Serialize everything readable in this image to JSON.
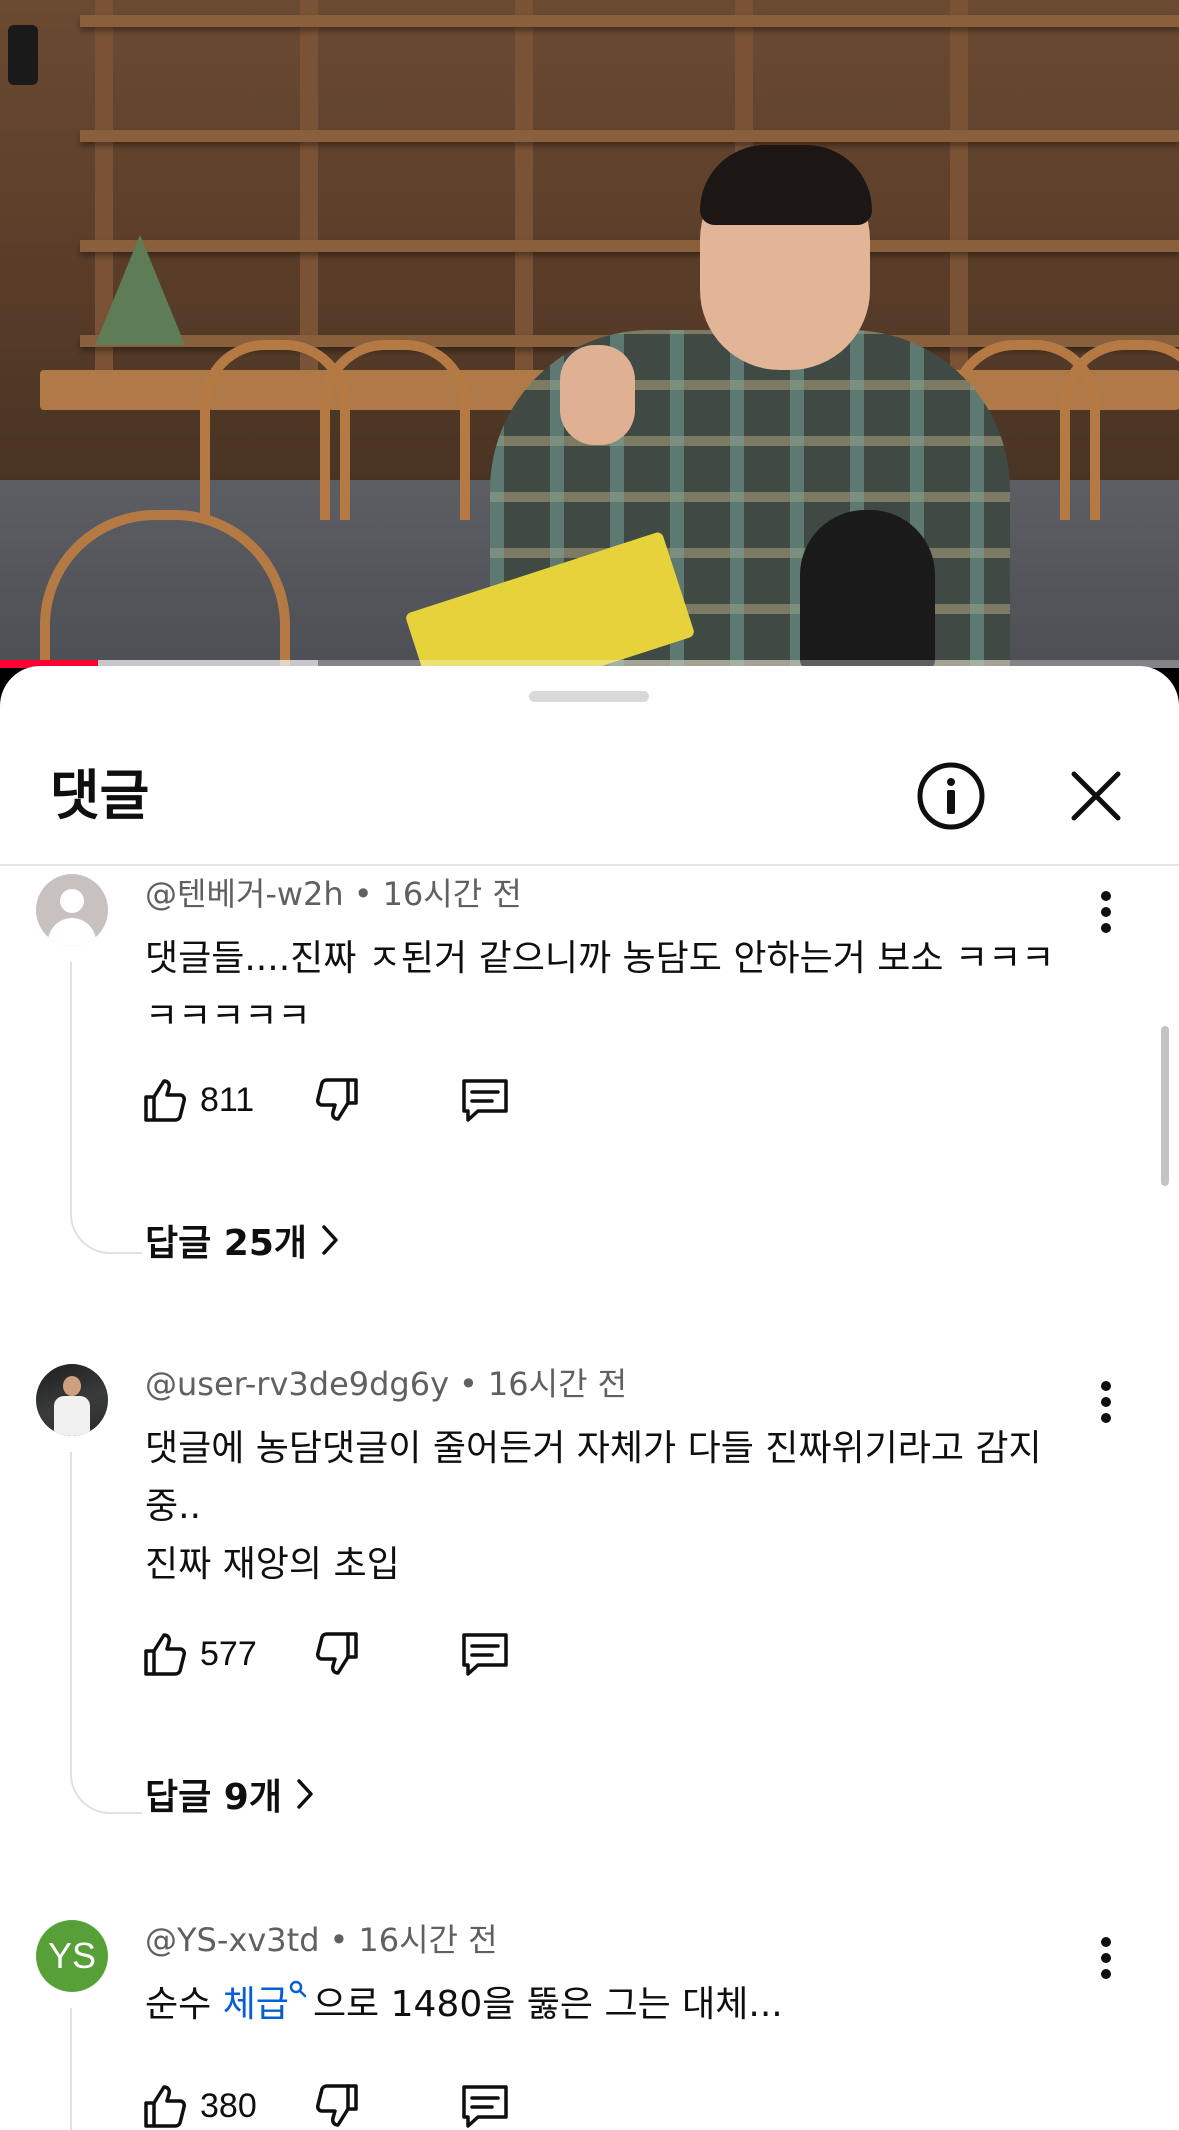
{
  "video": {
    "progress_played_fraction": 0.083,
    "progress_buffered_fraction": 0.27
  },
  "sheet": {
    "title": "댓글"
  },
  "comments": [
    {
      "handle": "@텐베거-w2h",
      "dot": "•",
      "time": "16시간 전",
      "lines": [
        "댓글들....진짜 ㅈ된거 같으니까 농담도 안하는거 보소 ㅋㅋㅋㅋㅋㅋㅋㅋ"
      ],
      "likes": "811",
      "replies": "답글 25개",
      "avatar": "default"
    },
    {
      "handle": "@user-rv3de9dg6y",
      "dot": "•",
      "time": "16시간 전",
      "lines": [
        "댓글에 농담댓글이 줄어든거 자체가 다들 진짜위기라고 감지중..",
        "진짜 재앙의 초입"
      ],
      "likes": "577",
      "replies": "답글 9개",
      "avatar": "photo"
    },
    {
      "handle": "@YS-xv3td",
      "dot": "•",
      "time": "16시간 전",
      "text_before": "순수 ",
      "hashtag": "체급",
      "text_after": "으로 1480을 뚫은 그는 대체...",
      "likes": "380",
      "avatar": "initials",
      "avatar_initials": "YS",
      "avatar_color": "#57a038"
    }
  ],
  "colors": {
    "progress": "#ff0033",
    "link": "#065fd4",
    "meta": "#606060"
  },
  "icons": {
    "info": "info-circle-icon",
    "close": "close-icon",
    "more": "more-vertical-icon",
    "like": "thumbs-up-icon",
    "dislike": "thumbs-down-icon",
    "reply": "reply-comment-icon",
    "chevron": "chevron-right-icon"
  }
}
